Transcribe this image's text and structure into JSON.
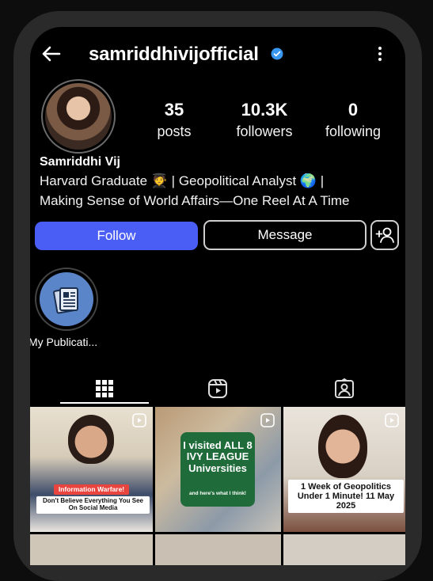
{
  "profile": {
    "username": "samriddhivijofficial",
    "display_name": "Samriddhi Vij",
    "bio_line1": "Harvard Graduate 🧑‍🎓 | Geopolitical Analyst 🌍 |",
    "bio_line2": "Making Sense of World Affairs—One Reel At A Time"
  },
  "stats": {
    "posts_count": "35",
    "posts_label": "posts",
    "followers_count": "10.3K",
    "followers_label": "followers",
    "following_count": "0",
    "following_label": "following"
  },
  "actions": {
    "follow_label": "Follow",
    "message_label": "Message"
  },
  "highlight": {
    "label": "My Publicati..."
  },
  "tabs": [
    "grid-icon",
    "reels-icon",
    "tagged-icon"
  ],
  "posts": [
    {
      "badge": "Information Warfare!",
      "caption": "Don't Believe Everything You See On Social Media"
    },
    {
      "caption": "I visited ALL 8 IVY LEAGUE Universities",
      "subcaption": "and here's what I think!"
    },
    {
      "caption": "1 Week of Geopolitics Under 1 Minute! 11 May 2025"
    }
  ],
  "colors": {
    "follow_button": "#4a5df5",
    "verified_badge": "#3897f0",
    "background": "#000000"
  }
}
